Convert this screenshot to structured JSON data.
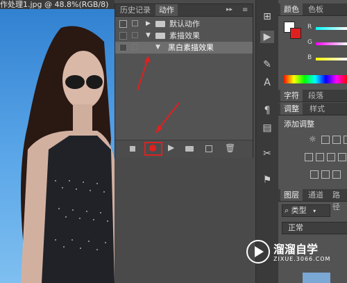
{
  "document": {
    "tab_title": "作处理1.jpg @ 48.8%(RGB/8)"
  },
  "actions_panel": {
    "tabs": [
      {
        "label": "历史记录"
      },
      {
        "label": "动作"
      }
    ],
    "menu_glyph": "▸▸",
    "rows": [
      {
        "label": "默认动作",
        "type": "set",
        "expanded": false
      },
      {
        "label": "素描效果",
        "type": "set",
        "expanded": true
      },
      {
        "label": "黑白素描效果",
        "type": "action",
        "selected": true
      }
    ]
  },
  "right_panels": {
    "color_tabs": [
      {
        "label": "颜色"
      },
      {
        "label": "色板"
      }
    ],
    "channels": [
      {
        "label": "R"
      },
      {
        "label": "G"
      },
      {
        "label": "B"
      }
    ],
    "char_tabs": [
      {
        "label": "字符"
      },
      {
        "label": "段落"
      }
    ],
    "adjust_tabs": [
      {
        "label": "调整"
      },
      {
        "label": "样式"
      }
    ],
    "adjust_title": "添加调整",
    "layer_tabs": [
      {
        "label": "图层"
      },
      {
        "label": "通道"
      },
      {
        "label": "路径"
      }
    ],
    "filter_kind": "类型",
    "blend_mode": "正常"
  },
  "watermark": {
    "title": "溜溜自学",
    "url": "ZIXUE.3066.COM"
  }
}
